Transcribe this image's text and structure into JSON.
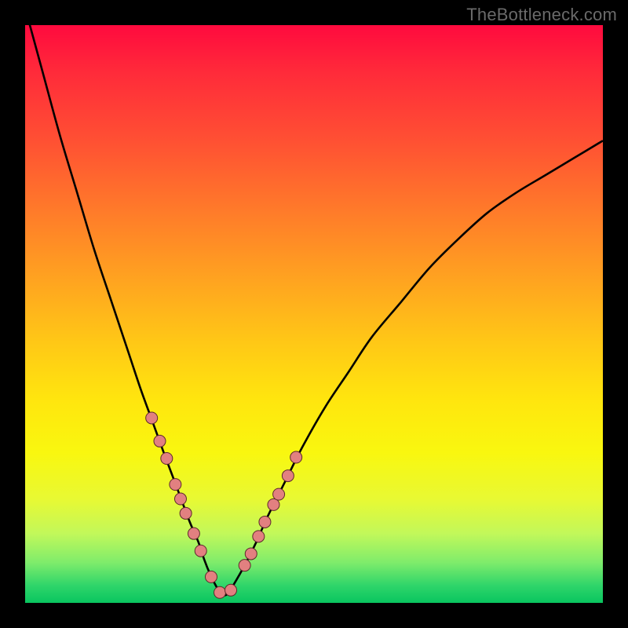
{
  "watermark": "TheBottleneck.com",
  "colors": {
    "frame": "#000000",
    "curve": "#000000",
    "dot_fill": "#e28080",
    "dot_stroke": "#5c2a2a"
  },
  "chart_data": {
    "type": "line",
    "title": "",
    "xlabel": "",
    "ylabel": "",
    "xlim": [
      0,
      100
    ],
    "ylim": [
      0,
      100
    ],
    "series": [
      {
        "name": "bottleneck-curve",
        "x": [
          0,
          3,
          6,
          9,
          12,
          15,
          18,
          20,
          22,
          24,
          25.5,
          27,
          28.5,
          30,
          31,
          32,
          33,
          34,
          35,
          36,
          38,
          40,
          42,
          45,
          48,
          52,
          56,
          60,
          65,
          70,
          75,
          80,
          85,
          90,
          95,
          100
        ],
        "y": [
          103,
          92,
          81,
          71,
          61,
          52,
          43,
          37,
          31.5,
          26,
          22,
          18,
          14,
          10.5,
          7.5,
          5,
          3,
          1.5,
          1.5,
          3,
          6.5,
          10.5,
          15,
          21,
          27,
          34,
          40,
          46,
          52,
          58,
          63,
          67.5,
          71,
          74,
          77,
          80
        ]
      }
    ],
    "dots": {
      "name": "highlight-points",
      "x": [
        21.9,
        23.3,
        24.5,
        26.0,
        26.9,
        27.8,
        29.2,
        30.4,
        32.2,
        33.7,
        35.6,
        38.0,
        39.1,
        40.4,
        41.5,
        43.0,
        43.9,
        45.5,
        46.9
      ],
      "y": [
        32.0,
        28.0,
        25.0,
        20.5,
        18.0,
        15.5,
        12.0,
        9.0,
        4.5,
        1.8,
        2.2,
        6.5,
        8.5,
        11.5,
        14.0,
        17.0,
        18.8,
        22.0,
        25.2
      ]
    }
  }
}
